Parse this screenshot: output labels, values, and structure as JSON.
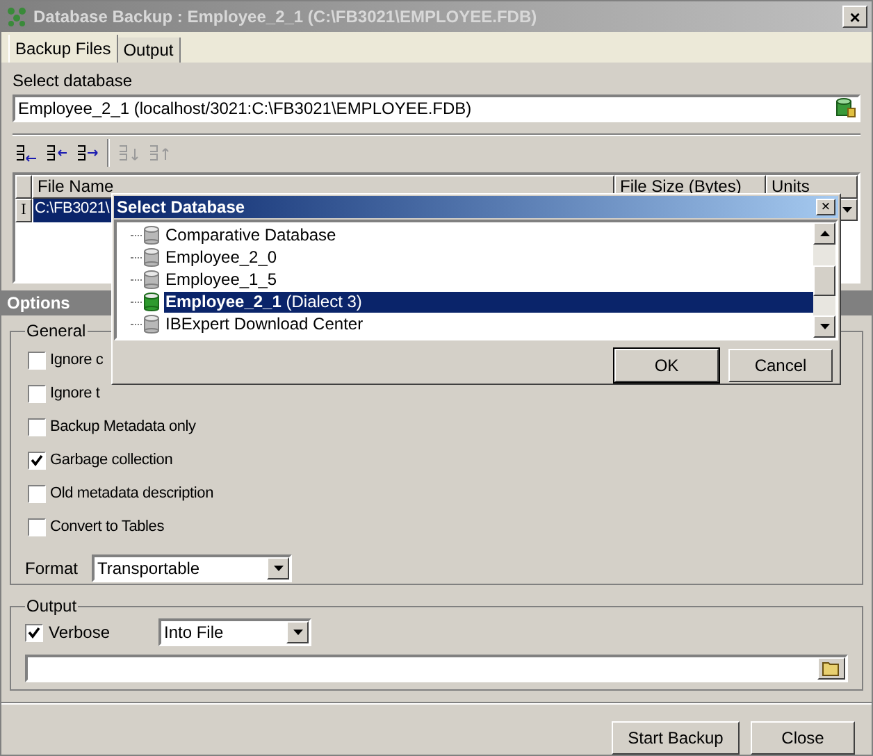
{
  "window": {
    "title": "Database Backup : Employee_2_1 (C:\\FB3021\\EMPLOYEE.FDB)",
    "close": "×"
  },
  "tabs": [
    {
      "label": "Backup Files",
      "selected": true
    },
    {
      "label": "Output",
      "selected": false
    }
  ],
  "select_database": {
    "label": "Select database",
    "value": "Employee_2_1 (localhost/3021:C:\\FB3021\\EMPLOYEE.FDB)"
  },
  "toolbar": [
    {
      "disabled": false
    },
    {
      "disabled": false
    },
    {
      "disabled": false
    },
    {
      "disabled": true
    },
    {
      "disabled": true
    }
  ],
  "grid": {
    "columns": [
      "File Name",
      "File Size (Bytes)",
      "Units"
    ],
    "rows": [
      {
        "indicator": "I",
        "file_name": "C:\\FB3021\\",
        "selected": true
      }
    ]
  },
  "options": {
    "title": "Options",
    "general": {
      "title": "General",
      "checkboxes": [
        {
          "label": "Ignore c",
          "checked": false
        },
        {
          "label": "Ignore t",
          "checked": false
        },
        {
          "label": "Backup Metadata only",
          "checked": false
        },
        {
          "label": "Garbage collection",
          "checked": true
        },
        {
          "label": "Old metadata description",
          "checked": false
        },
        {
          "label": "Convert to Tables",
          "checked": false
        }
      ],
      "format": {
        "label": "Format",
        "value": "Transportable"
      }
    },
    "output": {
      "title": "Output",
      "verbose": {
        "label": "Verbose",
        "checked": true
      },
      "mode": "Into File"
    }
  },
  "buttons": [
    "Start Backup",
    "Close"
  ],
  "dialog": {
    "title": "Select Database",
    "close": "×",
    "items": [
      {
        "label": "Comparative Database",
        "selected": false
      },
      {
        "label": "Employee_2_0",
        "selected": false
      },
      {
        "label": "Employee_1_5",
        "selected": false
      },
      {
        "label": "Employee_2_1",
        "detail": "(Dialect 3)",
        "selected": true
      },
      {
        "label": "IBExpert Download Center",
        "selected": false
      }
    ],
    "buttons": [
      "OK",
      "Cancel"
    ]
  }
}
